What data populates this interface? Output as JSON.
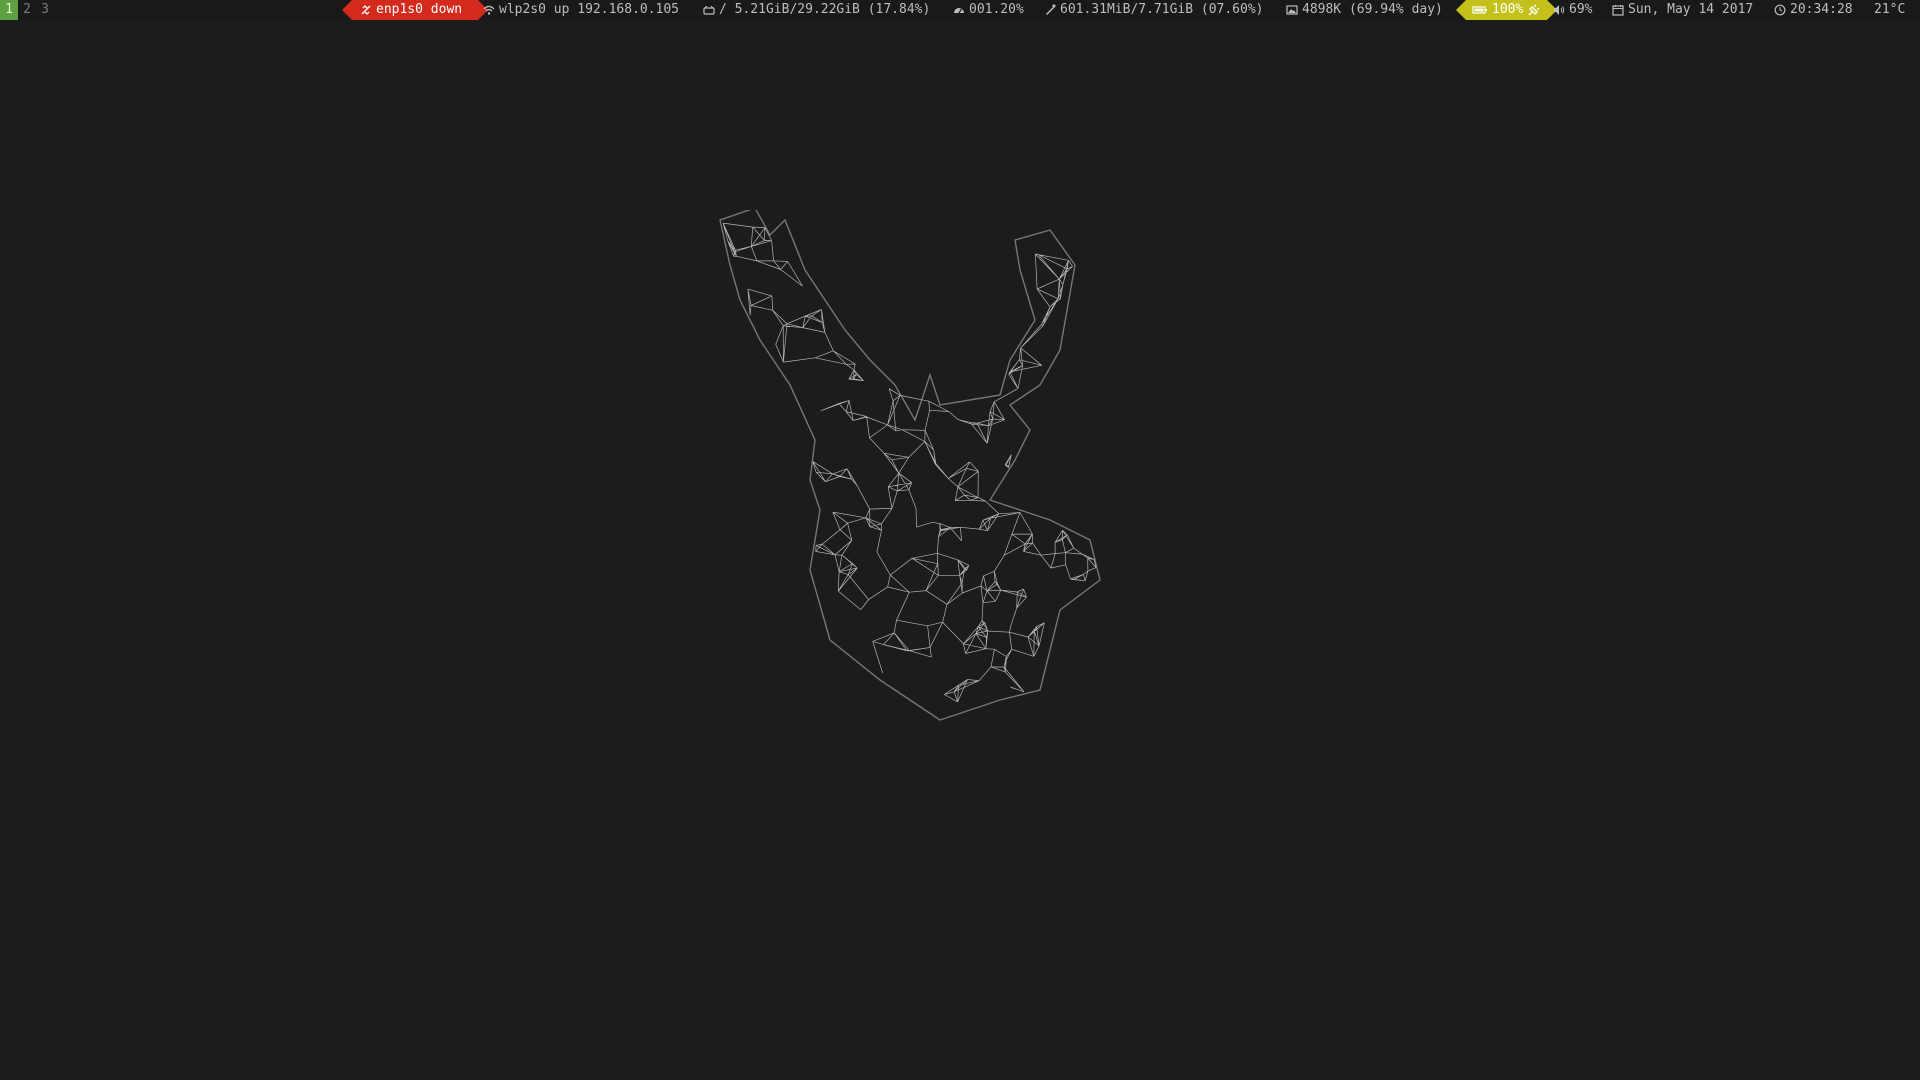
{
  "workspaces": [
    {
      "label": "1",
      "active": true
    },
    {
      "label": "2",
      "active": false
    },
    {
      "label": "3",
      "active": false
    }
  ],
  "status": {
    "ethernet": {
      "text": "enp1s0 down",
      "icon": "ethernet-unplugged-icon",
      "color": "#d42a1e"
    },
    "wireless": {
      "text": "wlp2s0 up 192.168.0.105",
      "icon": "wifi-icon"
    },
    "disk": {
      "text": "/ 5.21GiB/29.22GiB (17.84%)",
      "icon": "disk-icon"
    },
    "cpu": {
      "text": "001.20%",
      "icon": "speedometer-icon"
    },
    "memory": {
      "text": "601.31MiB/7.71GiB (07.60%)",
      "icon": "memory-icon"
    },
    "backlight": {
      "text": "4898K (69.94% day)",
      "icon": "image-icon"
    },
    "battery": {
      "text": "100%",
      "icon": "battery-icon",
      "charging_icon": "plug-icon",
      "color": "#c4c21a"
    },
    "volume": {
      "text": "69%",
      "icon": "speaker-icon"
    },
    "date": {
      "text": "Sun, May 14 2017",
      "icon": "calendar-icon"
    },
    "time": {
      "text": "20:34:28",
      "icon": "clock-icon"
    },
    "temperature": {
      "text": "21°C"
    }
  },
  "colors": {
    "background": "#1c1c1c",
    "bar_background": "#191919",
    "bar_text": "#bdbdbd",
    "workspace_active": "#5fa042",
    "wallpaper_lines": "#e6e6e6"
  },
  "wallpaper": {
    "subject": "low-poly stag head"
  }
}
